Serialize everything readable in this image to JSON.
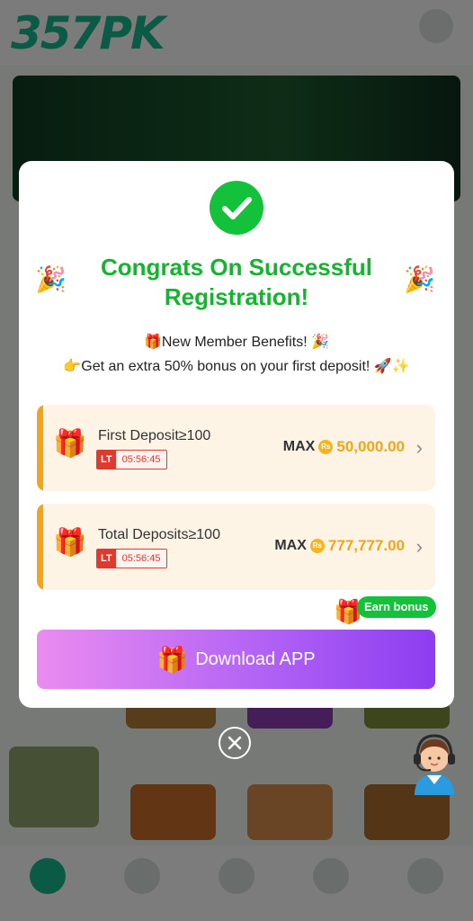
{
  "background": {
    "logo": "357PK"
  },
  "modal": {
    "title": "Congrats On Successful Registration!",
    "benefit_line1": "🎁New Member Benefits! 🎉",
    "benefit_line2": "👉Get an extra 50% bonus on your first deposit! 🚀✨",
    "cards": [
      {
        "label": "First Deposit≥100",
        "timer_tag": "LT",
        "timer": "05:56:45",
        "max_label": "MAX",
        "currency": "Rs",
        "amount": "50,000.00"
      },
      {
        "label": "Total Deposits≥100",
        "timer_tag": "LT",
        "timer": "05:56:45",
        "max_label": "MAX",
        "currency": "Rs",
        "amount": "777,777.00"
      }
    ],
    "earn_bonus": "Earn bonus",
    "download_label": "Download APP"
  },
  "colors": {
    "accent_green": "#13c13a",
    "bar_orange": "#f2a51a",
    "button_gradient": [
      "#ea8cf0",
      "#8d3df0"
    ]
  },
  "icons": {
    "check": "checkmark-circle-icon",
    "party": "party-popper-icon",
    "gift": "gift-box-icon",
    "chevron": "chevron-right-icon",
    "close": "close-circle-icon",
    "support": "customer-support-icon"
  }
}
